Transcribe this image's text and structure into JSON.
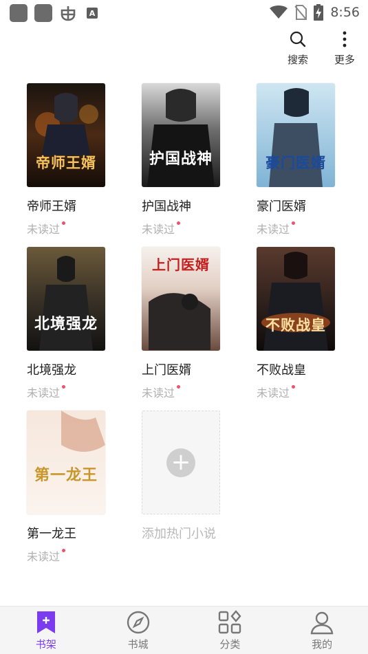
{
  "status_bar": {
    "time": "8:56",
    "a_badge": "A"
  },
  "top_actions": [
    {
      "label": "搜索",
      "icon": "search-icon"
    },
    {
      "label": "更多",
      "icon": "more-vertical-icon"
    }
  ],
  "books": [
    {
      "title": "帝师王婿",
      "status": "未读过",
      "cover_text": "帝师王婿"
    },
    {
      "title": "护国战神",
      "status": "未读过",
      "cover_text": "护国战神"
    },
    {
      "title": "豪门医婿",
      "status": "未读过",
      "cover_text": "豪门医婿"
    },
    {
      "title": "北境强龙",
      "status": "未读过",
      "cover_text": "北境强龙"
    },
    {
      "title": "上门医婿",
      "status": "未读过",
      "cover_text": "上门医婿"
    },
    {
      "title": "不败战皇",
      "status": "未读过",
      "cover_text": "不败战皇"
    },
    {
      "title": "第一龙王",
      "status": "未读过",
      "cover_text": "第一龙王"
    }
  ],
  "add_tile": {
    "label": "添加热门小说",
    "icon": "plus-icon"
  },
  "bottom_nav": [
    {
      "label": "书架",
      "icon": "bookshelf-icon",
      "active": true
    },
    {
      "label": "书城",
      "icon": "compass-icon",
      "active": false
    },
    {
      "label": "分类",
      "icon": "category-grid-icon",
      "active": false
    },
    {
      "label": "我的",
      "icon": "profile-icon",
      "active": false
    }
  ],
  "colors": {
    "accent": "#7b3cf0",
    "unread_dot": "#f0506e",
    "muted_text": "#b0b0b0"
  }
}
